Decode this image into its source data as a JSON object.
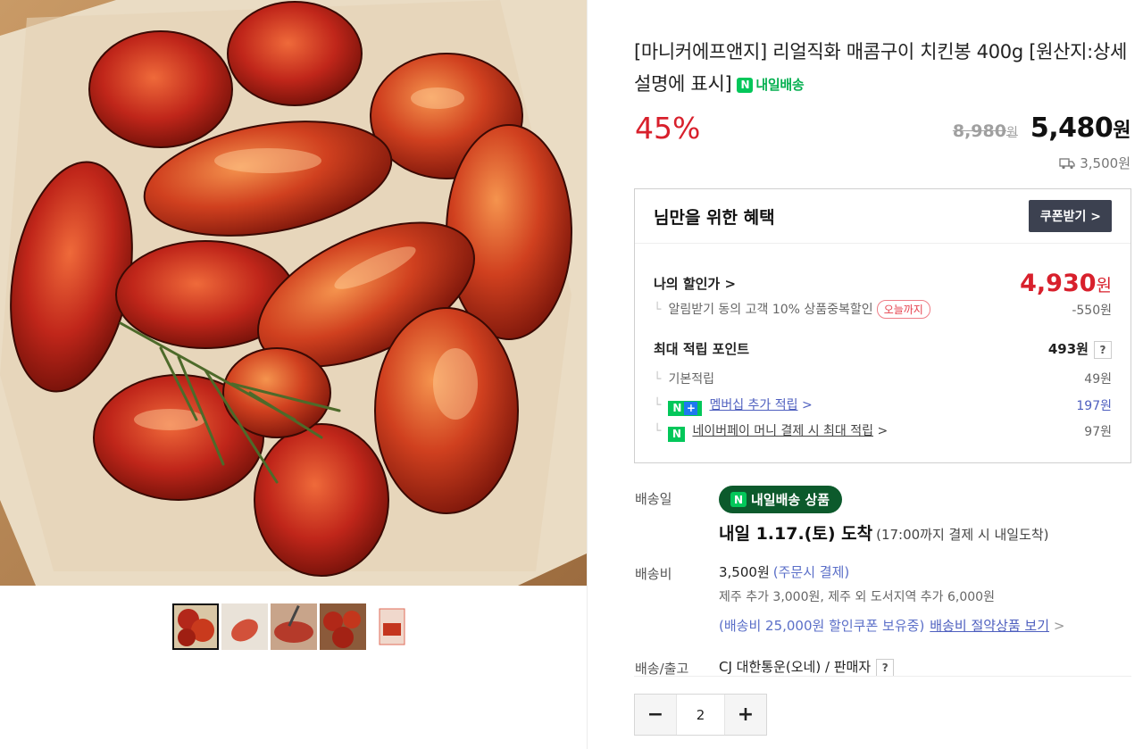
{
  "product": {
    "title": "[마니커에프앤지] 리얼직화 매콤구이 치킨봉 400g [원산지:상세설명에 표시]",
    "tomorrow_delivery_label": "내일배송",
    "discount_rate": "45%",
    "original_price": "8,980",
    "sale_price": "5,480",
    "price_unit": "원",
    "shipping_fee_short": "3,500원"
  },
  "thumbnails": {
    "count": 5,
    "active_index": 0
  },
  "benefit": {
    "title": "님만을 위한 혜택",
    "coupon_button": "쿠폰받기 >",
    "my_price_label": "나의 할인가 >",
    "my_price_value": "4,930",
    "my_price_unit": "원",
    "notify_discount_label": "알림받기 동의 고객 10% 상품중복할인",
    "today_only_badge": "오늘까지",
    "notify_discount_value": "-550원",
    "max_points_label": "최대 적립 포인트",
    "max_points_value": "493원",
    "help_mark": "?",
    "basic_points_label": "기본적립",
    "basic_points_value": "49원",
    "membership_label": "멤버십 추가 적립",
    "membership_value": "197원",
    "npay_label": "네이버페이 머니 결제 시 최대 적립",
    "npay_value": "97원",
    "chevron": ">"
  },
  "delivery": {
    "date_label": "배송일",
    "badge_label": "내일배송 상품",
    "arrival_text": "내일 1.17.(토) 도착",
    "arrival_note": "(17:00까지 결제 시 내일도착)",
    "fee_label": "배송비",
    "fee_value": "3,500원",
    "fee_payment": "(주문시 결제)",
    "extra_fee": "제주 추가 3,000원, 제주 외 도서지역 추가 6,000원",
    "coupon_note": "(배송비 25,000원 할인쿠폰 보유중)",
    "saving_link": "배송비 절약상품 보기",
    "courier_label": "배송/출고",
    "courier_value": "CJ 대한통운(오네) / 판매자"
  },
  "quantity": {
    "minus": "−",
    "value": "2",
    "plus": "+"
  },
  "colors": {
    "discount_red": "#d8202c",
    "naver_green": "#03c75a",
    "link_blue": "#4e5fbf"
  },
  "icons": [
    "n-delivery-icon",
    "truck-icon",
    "n-plus-icon",
    "npay-icon",
    "chevron-right-icon",
    "help-icon"
  ]
}
